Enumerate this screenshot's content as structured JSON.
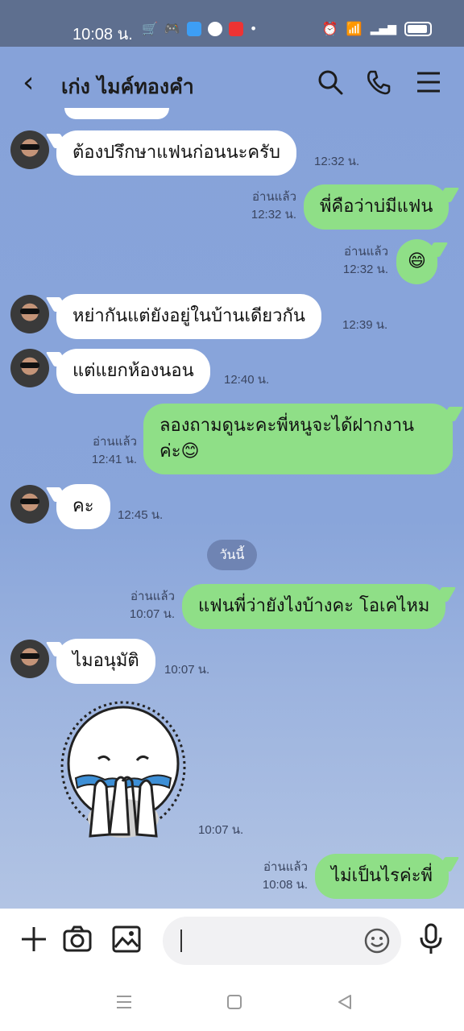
{
  "status_bar": {
    "time": "10:08 น."
  },
  "header": {
    "title": "เก่ง ไมค์ทองคำ"
  },
  "messages": [
    {
      "text": "ต้องปรึกษาแฟนก่อนนะครับ",
      "time": "12:32 น."
    },
    {
      "text": "พี่คือว่าบ่มีแฟน",
      "read": "อ่านแล้ว",
      "time": "12:32 น."
    },
    {
      "text": "😄",
      "read": "อ่านแล้ว",
      "time": "12:32 น."
    },
    {
      "text": "หย่ากันแต่ยังอยู่ในบ้านเดียวกัน",
      "time": "12:39 น."
    },
    {
      "text": "แต่แยกห้องนอน",
      "time": "12:40 น."
    },
    {
      "line1": "ลองถามดูนะคะพี่หนูจะได้ฝากงาน",
      "line2": "ค่ะ😊",
      "read": "อ่านแล้ว",
      "time": "12:41 น."
    },
    {
      "text": "คะ",
      "time": "12:45 น."
    },
    {
      "text": "แฟนพี่ว่ายังไงบ้างคะ โอเคไหม",
      "read": "อ่านแล้ว",
      "time": "10:07 น."
    },
    {
      "text": "ไมอนุมัติ",
      "time": "10:07 น."
    },
    {
      "sticker": "crying-character-sticker",
      "time": "10:07 น."
    },
    {
      "text": "ไม่เป็นไรค่ะพี่",
      "read": "อ่านแล้ว",
      "time": "10:08 น."
    }
  ],
  "date_divider": "วันนี้",
  "colors": {
    "incoming": "#ffffff",
    "outgoing": "#8fdf87",
    "background": "#8fa6d6"
  }
}
